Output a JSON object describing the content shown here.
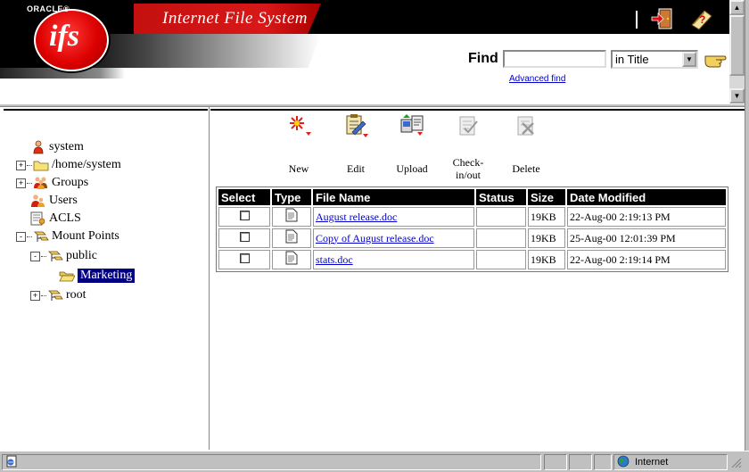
{
  "header": {
    "oracle_label": "ORACLE®",
    "logo_text": "ifs",
    "app_title": "Internet File System",
    "find_label": "Find",
    "find_value": "",
    "find_scope": "in Title",
    "advanced_find": "Advanced find",
    "icons": [
      "logout-icon",
      "help-icon",
      "find-go-pointer-icon"
    ]
  },
  "tree": {
    "items": [
      {
        "label": "system",
        "icon": "user-icon",
        "expander": ""
      },
      {
        "label": "/home/system",
        "icon": "folder-icon",
        "expander": "+"
      },
      {
        "label": "Groups",
        "icon": "groups-icon",
        "expander": "+"
      },
      {
        "label": "Users",
        "icon": "users-icon",
        "expander": ""
      },
      {
        "label": "ACLS",
        "icon": "acl-icon",
        "expander": ""
      },
      {
        "label": "Mount Points",
        "icon": "mount-point-icon",
        "expander": "-"
      },
      {
        "label": "public",
        "icon": "mount-point-icon",
        "expander": "-"
      },
      {
        "label": "Marketing",
        "icon": "open-folder-icon",
        "expander": "",
        "selected": true
      },
      {
        "label": "root",
        "icon": "mount-point-icon",
        "expander": "+"
      }
    ]
  },
  "toolbar": {
    "new_label": "New",
    "edit_label": "Edit",
    "upload_label": "Upload",
    "checkinout_label": "Check-\nin/out",
    "delete_label": "Delete"
  },
  "table": {
    "columns": [
      "Select",
      "Type",
      "File Name",
      "Status",
      "Size",
      "Date Modified"
    ],
    "rows": [
      {
        "name": "August release.doc",
        "status": "",
        "size": "19KB",
        "modified": "22-Aug-00 2:19:13 PM"
      },
      {
        "name": "Copy of August release.doc",
        "status": "",
        "size": "19KB",
        "modified": "25-Aug-00 12:01:39 PM"
      },
      {
        "name": "stats.doc",
        "status": "",
        "size": "19KB",
        "modified": "22-Aug-00 2:19:14 PM"
      }
    ]
  },
  "statusbar": {
    "message": "",
    "zone": "Internet"
  },
  "colors": {
    "accent_red": "#d81818",
    "selection": "#000080",
    "link": "#0000cc",
    "chrome": "#c0c0c0"
  }
}
